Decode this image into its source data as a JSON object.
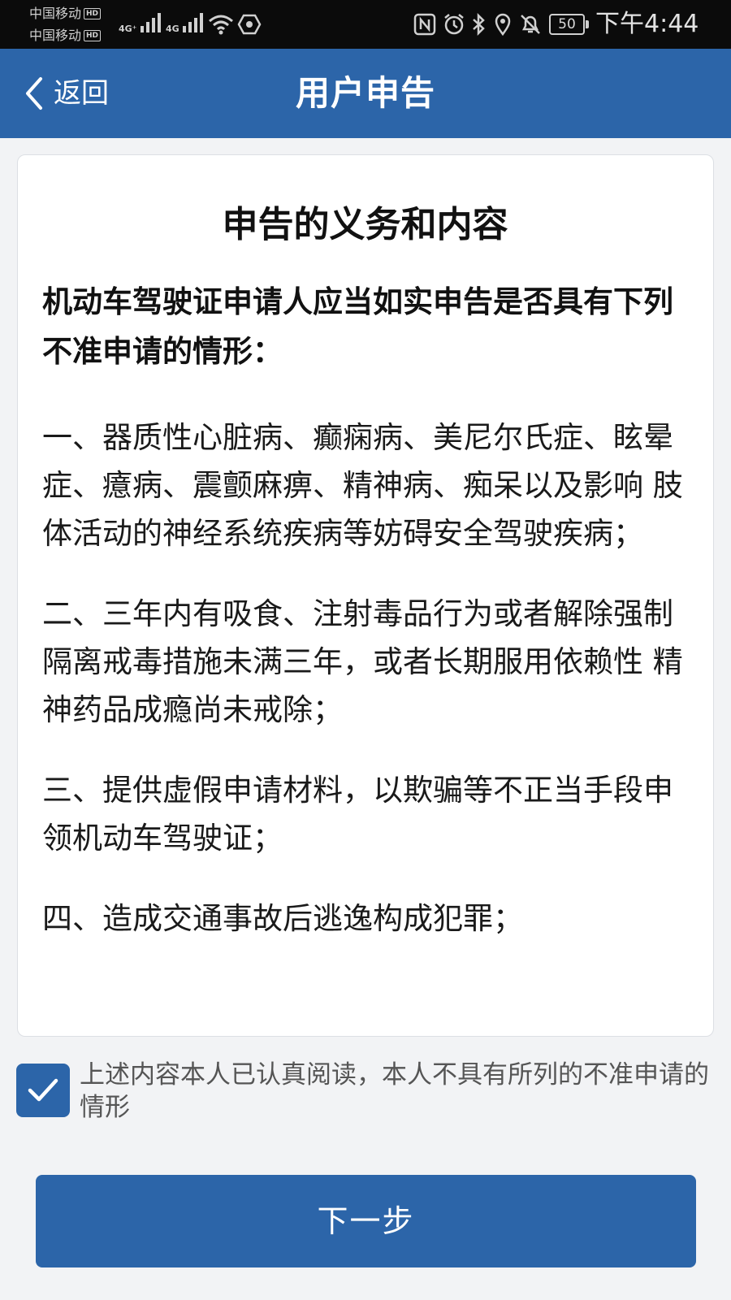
{
  "status_bar": {
    "carrier1": "中国移动",
    "carrier2": "中国移动",
    "hd": "HD",
    "net1": "4G⁺",
    "net2": "4G",
    "battery": "50",
    "time": "下午4:44",
    "icons": [
      "signal-icon",
      "wifi-icon",
      "nfc-icon",
      "alarm-icon",
      "bluetooth-icon",
      "location-icon",
      "mute-icon",
      "battery-icon"
    ]
  },
  "header": {
    "back_label": "返回",
    "title": "用户申告"
  },
  "card": {
    "title": "申告的义务和内容",
    "intro": "机动车驾驶证申请人应当如实申告是否具有下列不准申请的情形：",
    "clauses": [
      "一、器质性心脏病、癫痫病、美尼尔氏症、眩晕症、癔病、震颤麻痹、精神病、痴呆以及影响 肢体活动的神经系统疾病等妨碍安全驾驶疾病；",
      "二、三年内有吸食、注射毒品行为或者解除强制隔离戒毒措施未满三年，或者长期服用依赖性 精神药品成瘾尚未戒除；",
      "三、提供虚假申请材料，以欺骗等不正当手段申领机动车驾驶证；",
      "四、造成交通事故后逃逸构成犯罪；"
    ]
  },
  "agreement": {
    "checked": true,
    "text": "上述内容本人已认真阅读，本人不具有所列的不准申请的情形"
  },
  "next_button": {
    "label": "下一步"
  },
  "colors": {
    "primary": "#2c65a9",
    "status_bar": "#0b0b0b",
    "background": "#f2f3f5"
  }
}
